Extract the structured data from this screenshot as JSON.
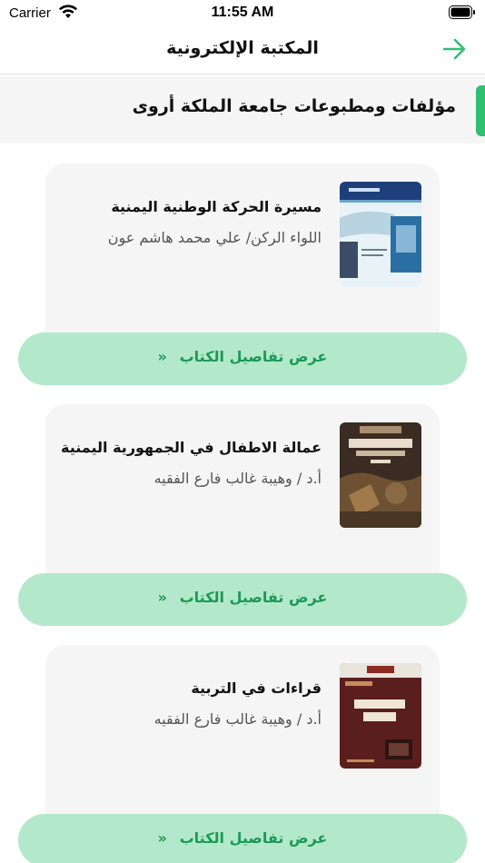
{
  "status": {
    "carrier": "Carrier",
    "time": "11:55 AM"
  },
  "nav": {
    "title": "المكتبة الإلكترونية"
  },
  "section": {
    "title": "مؤلفات ومطبوعات جامعة الملكة أروى"
  },
  "books": [
    {
      "title": "مسيرة الحركة الوطنية اليمنية",
      "author": "اللواء الركن/ علي محمد هاشم عون",
      "details_label": "عرض تفاصيل الكتاب"
    },
    {
      "title": "عمالة الاطفال في الجمهورية اليمنية",
      "author": "أ.د / وهيبة غالب فارع الفقيه",
      "details_label": "عرض تفاصيل الكتاب"
    },
    {
      "title": "قراءات في التربية",
      "author": "أ.د / وهيبة غالب فارع الفقيه",
      "details_label": "عرض تفاصيل الكتاب"
    }
  ],
  "colors": {
    "accent": "#2fbf71",
    "button_bg": "#b3e8cb",
    "button_text": "#1a9a55",
    "card_bg": "#f5f5f5"
  }
}
